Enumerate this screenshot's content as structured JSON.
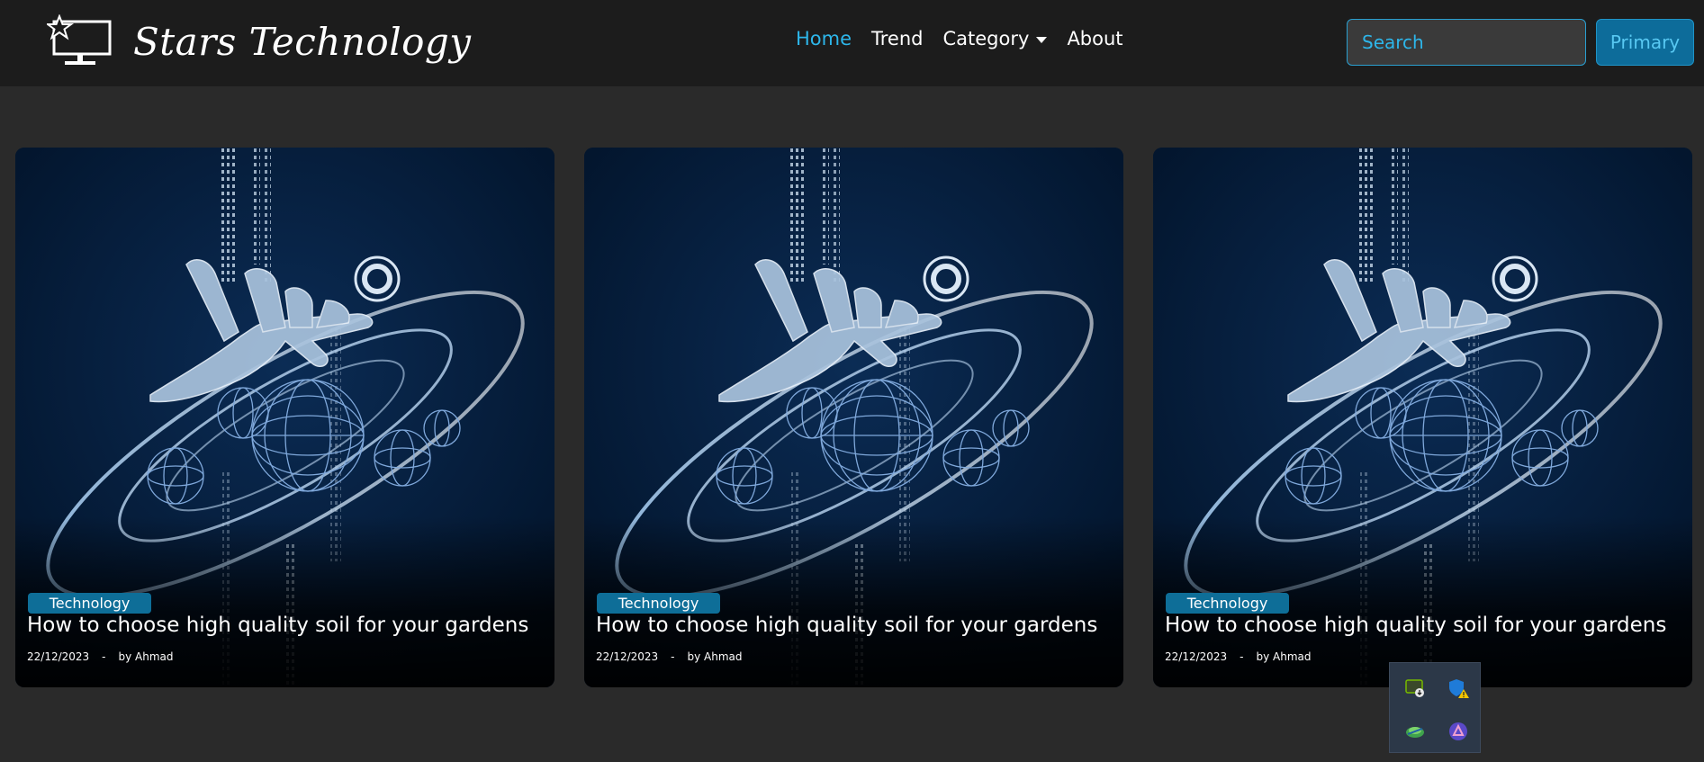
{
  "navbar": {
    "brand": "Stars Technology",
    "brand_icon": "star-monitor-logo-icon",
    "links": [
      {
        "label": "Home",
        "active": true
      },
      {
        "label": "Trend",
        "active": false
      },
      {
        "label": "Category",
        "active": false,
        "dropdown": true
      },
      {
        "label": "About",
        "active": false
      }
    ],
    "search_placeholder": "Search",
    "primary_label": "Primary"
  },
  "cards": [
    {
      "category": "Technology",
      "title": "How to choose high quality soil for your gardens",
      "date": "22/12/2023",
      "separator": "-",
      "author": "by Ahmad"
    },
    {
      "category": "Technology",
      "title": "How to choose high quality soil for your gardens",
      "date": "22/12/2023",
      "separator": "-",
      "author": "by Ahmad"
    },
    {
      "category": "Technology",
      "title": "How to choose high quality soil for your gardens",
      "date": "22/12/2023",
      "separator": "-",
      "author": "by Ahmad"
    }
  ],
  "tray": {
    "icons": [
      "nvidia-update-icon",
      "security-warning-icon",
      "network-globe-icon",
      "app-launcher-icon"
    ]
  },
  "colors": {
    "accent": "#2db6ea",
    "navbar_bg": "#1c1c1c",
    "page_bg": "#2a2a2a",
    "badge_bg": "#0e6e98"
  }
}
